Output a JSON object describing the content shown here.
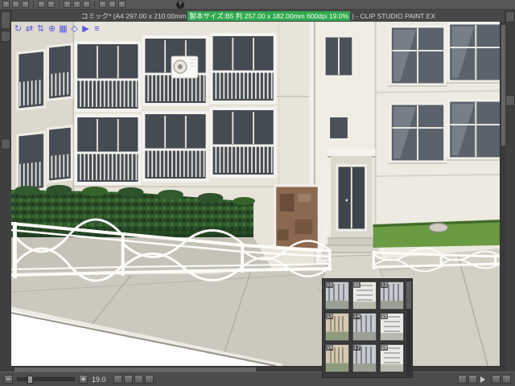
{
  "titlebar": {
    "pre": "コミック* (A4 297.00 x 210.00mm ",
    "highlight": "製本サイズ:B5 判 257.00 x 182.00mm 600dpi 19.0%",
    "post": ") - CLIP STUDIO PAINT EX"
  },
  "toolbar": {
    "help_label": "?"
  },
  "gizmos": [
    {
      "name": "camera-rotate",
      "glyph": "↻"
    },
    {
      "name": "camera-pan",
      "glyph": "⇄"
    },
    {
      "name": "camera-dolly",
      "glyph": "⇅"
    },
    {
      "name": "object-move",
      "glyph": "⊕"
    },
    {
      "name": "object-snap-grid",
      "glyph": "▦"
    },
    {
      "name": "object-rotate",
      "glyph": "◇"
    },
    {
      "name": "play-pose",
      "glyph": "▶"
    },
    {
      "name": "object-menu",
      "glyph": "≡"
    }
  ],
  "materials": {
    "items": [
      {
        "label": "10",
        "tone": "a"
      },
      {
        "label": "11",
        "tone": "b"
      },
      {
        "label": "12",
        "tone": "a"
      },
      {
        "label": "13",
        "tone": "c"
      },
      {
        "label": "14",
        "tone": "a"
      },
      {
        "label": "15",
        "tone": "b"
      },
      {
        "label": "16",
        "tone": "c"
      },
      {
        "label": "17",
        "tone": "a"
      },
      {
        "label": "18",
        "tone": "b"
      }
    ]
  },
  "statusbar": {
    "zoom": "19.0"
  },
  "colors": {
    "accent_green": "#2fa84f",
    "gizmo_blue": "#5b5bd6",
    "fence_white": "#fcfcf9"
  }
}
